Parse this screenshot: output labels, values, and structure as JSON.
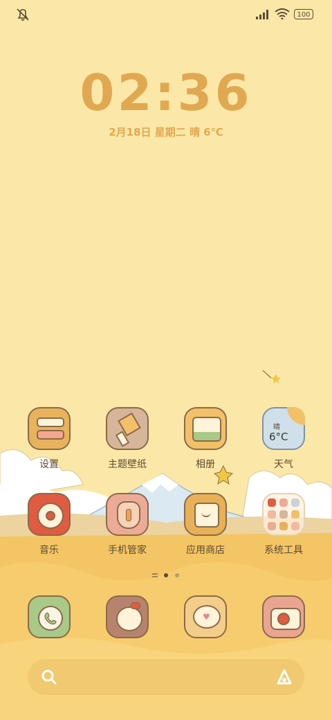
{
  "status": {
    "battery": "100"
  },
  "clock": {
    "time": "02:36",
    "date": "2月18日  星期二  晴  6℃"
  },
  "weather_widget": {
    "condition": "晴",
    "temp": "6°C"
  },
  "apps_row1": [
    {
      "label": "设置",
      "icon": "settings-icon",
      "color": "#e9b25d"
    },
    {
      "label": "主题壁纸",
      "icon": "theme-icon",
      "color": "#d6b59b"
    },
    {
      "label": "相册",
      "icon": "gallery-icon",
      "color": "#f2c069"
    },
    {
      "label": "天气",
      "icon": "weather-icon",
      "color": "#cfe0ea"
    }
  ],
  "apps_row2": [
    {
      "label": "音乐",
      "icon": "music-icon",
      "color": "#e05b41"
    },
    {
      "label": "手机管家",
      "icon": "security-icon",
      "color": "#ecab96"
    },
    {
      "label": "应用商店",
      "icon": "appstore-icon",
      "color": "#e8b158"
    },
    {
      "label": "系统工具",
      "icon": "folder-icon",
      "color": "#f4e2c4"
    }
  ],
  "dock": [
    {
      "icon": "phone-icon",
      "color": "#a8c987"
    },
    {
      "icon": "contacts-icon",
      "color": "#b8836e"
    },
    {
      "icon": "messages-icon",
      "color": "#f4cd8a"
    },
    {
      "icon": "camera-icon",
      "color": "#eaa492"
    }
  ]
}
